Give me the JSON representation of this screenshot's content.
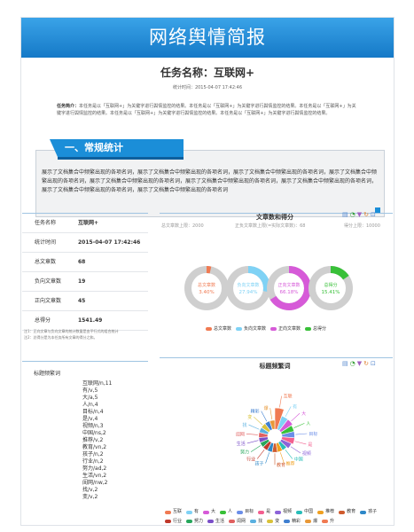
{
  "header": {
    "title": "网络舆情简报"
  },
  "task": {
    "title": "任务名称：互联网+",
    "stat_time": "统计时间：2015-04-07 17:42:46"
  },
  "intro": {
    "label": "任务简介：",
    "text": "本任务是以「互联网+」为关键字进行舆情监控的结果。本任务是以「互联网+」为关键字进行舆情监控的结果。本任务是以「互联网+」为关键字进行舆情监控的结果。本任务是以「互联网+」为关键字进行舆情监控的结果。本任务是以「互联网+」为关键字进行舆情监控的结果。"
  },
  "section1": {
    "title": "一、常规统计",
    "body": "展示了文档集合中频繁出现的各项名词，展示了文档集合中频繁出现的各项名词，展示了文档集合中频繁出现的各项名词，展示了文档集合中频繁出现的各项名词，展示了文档集合中频繁出现的各项名词，展示了文档集合中频繁出现的各项名词，展示了文档集合中频繁出现的各项名词，展示了文档集合中频繁出现的各项名词，展示了文档集合中频繁出现的各项名词"
  },
  "stats": [
    {
      "key": "任务名称",
      "value": "互联网+"
    },
    {
      "key": "统计时间",
      "value": "2015-04-07 17:42:46"
    },
    {
      "key": "总文章数",
      "value": "68"
    },
    {
      "key": "负向文章数",
      "value": "19"
    },
    {
      "key": "正向文章数",
      "value": "45"
    },
    {
      "key": "总得分",
      "value": "1541.49"
    }
  ],
  "notes": [
    "注1：正向文章与负向文章的统计数量是由平行式的组合统计",
    "注2：总得分是为本任务所有文章的得分之和。"
  ],
  "tags": {
    "title": "标题频繁词",
    "items": [
      "互联网/n,11",
      "有/v,5",
      "大/a,5",
      "人/n,4",
      "目标/n,4",
      "是/v,4",
      "视频/n,3",
      "中国/ns,2",
      "推荐/v,2",
      "教育/vn,2",
      "孩子/n,2",
      "行业/n,2",
      "努力/ad,2",
      "生活/vn,2",
      "闺网/nw,2",
      "找/v,2",
      "变/v,2"
    ]
  },
  "chart_data": [
    {
      "type": "pie",
      "title": "文章数和得分",
      "subtitles": [
        "总文章数上限：2000",
        "正负文章数上限(=实际文章数)：68",
        "得分上限：10000"
      ],
      "series": [
        {
          "name": "总文章数",
          "label": "总文章数",
          "value": 3.4,
          "display": "3.40%",
          "color": "#f07a52"
        },
        {
          "name": "负向文章数",
          "label": "负向文章数",
          "value": 27.94,
          "display": "27.94%",
          "color": "#7fd2f5"
        },
        {
          "name": "正向文章数",
          "label": "正向文章数",
          "value": 66.18,
          "display": "66.18%",
          "color": "#d65ad8"
        },
        {
          "name": "总得分",
          "label": "总得分",
          "value": 15.41,
          "display": "15.41%",
          "color": "#38c038"
        }
      ]
    },
    {
      "type": "pie",
      "title": "标题频繁词",
      "categories": [
        "互联",
        "有",
        "大",
        "人",
        "目标",
        "是",
        "视频",
        "中国",
        "推荐",
        "教育",
        "孩子",
        "行业",
        "努力",
        "生活",
        "闺网",
        "找",
        "变",
        "精彩",
        "爆"
      ],
      "values": [
        11,
        5,
        5,
        4,
        4,
        4,
        3,
        2,
        2,
        2,
        2,
        2,
        2,
        2,
        2,
        2,
        2,
        2,
        2
      ],
      "colors": [
        "#f07a52",
        "#7fd2f5",
        "#d65ad8",
        "#38c038",
        "#6b8ee8",
        "#f35f8f",
        "#8c63d8",
        "#29bdb8",
        "#f0a020",
        "#cf5b2e",
        "#2e88c8",
        "#c0392b",
        "#27a75c",
        "#7b4fc8",
        "#e06060",
        "#5ab0e0",
        "#d9c23a",
        "#3f7fd0",
        "#e89838"
      ],
      "legend": [
        "互联",
        "有",
        "大",
        "人",
        "目标",
        "是",
        "视频",
        "中国",
        "推荐",
        "教育",
        "孩子",
        "行业",
        "努力",
        "生活",
        "闺网",
        "找",
        "变",
        "精彩",
        "爆",
        "升"
      ]
    }
  ],
  "tools_icons": [
    "data-view-icon",
    "line-icon",
    "bar-icon",
    "restore-icon",
    "save-icon"
  ]
}
